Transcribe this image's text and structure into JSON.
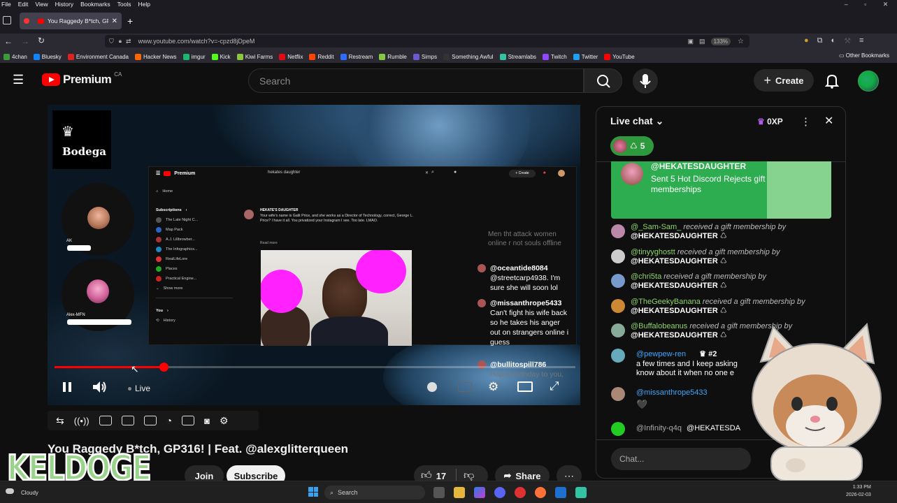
{
  "browser": {
    "menu": [
      "File",
      "Edit",
      "View",
      "History",
      "Bookmarks",
      "Tools",
      "Help"
    ],
    "tab_title": "You Raggedy B*tch, GP316! | Feat. @alexglitterqueen",
    "tab_title_display": "You Raggedy B*tch, GP316",
    "url": "www.youtube.com/watch?v=-cpzd8jDpeM",
    "zoom": "133%",
    "bookmarks": [
      {
        "label": "4chan",
        "color": "#3b9b3b"
      },
      {
        "label": "Bluesky",
        "color": "#1185fe"
      },
      {
        "label": "Environment Canada",
        "color": "#d22"
      },
      {
        "label": "Hacker News",
        "color": "#ff6600"
      },
      {
        "label": "imgur",
        "color": "#1bb76e"
      },
      {
        "label": "Kick",
        "color": "#53fc18"
      },
      {
        "label": "Kiwi Farms",
        "color": "#8cc63f"
      },
      {
        "label": "Netflix",
        "color": "#e50914"
      },
      {
        "label": "Reddit",
        "color": "#ff4500"
      },
      {
        "label": "Restream",
        "color": "#2f6bff"
      },
      {
        "label": "Rumble",
        "color": "#85c742"
      },
      {
        "label": "Simps",
        "color": "#6a5acd"
      },
      {
        "label": "Something Awful",
        "color": "#333"
      },
      {
        "label": "Streamlabs",
        "color": "#31c3a2"
      },
      {
        "label": "Twitch",
        "color": "#9146ff"
      },
      {
        "label": "Twitter",
        "color": "#1da1f2"
      },
      {
        "label": "YouTube",
        "color": "#ff0000"
      }
    ],
    "other_bookmarks": "Other Bookmarks"
  },
  "youtube": {
    "logo": "Premium",
    "region": "CA",
    "search_placeholder": "Search",
    "create_label": "Create",
    "video_title": "You Raggedy B*tch, GP316! | Feat. @alexglitterqueen",
    "join_label": "Join",
    "subscribe_label": "Subscribe",
    "like_count": "17",
    "share_label": "Share",
    "player": {
      "live_label": "Live",
      "progress": 0.21,
      "bodega_label": "Bodega",
      "participant_1": "AK",
      "participant_2": "Alex-MFN",
      "inner": {
        "logo": "Premium",
        "search_text": "hekates daughter",
        "create": "Create",
        "home": "Home",
        "subscriptions": "Subscriptions",
        "subs": [
          {
            "label": "The Late Night C...",
            "color": "#555"
          },
          {
            "label": "Map Pack",
            "color": "#2a66c9"
          },
          {
            "label": "A.J. Lillbrowber...",
            "color": "#a33"
          },
          {
            "label": "The Infographics...",
            "color": "#1e88c4"
          },
          {
            "label": "RealLifeLore",
            "color": "#d33"
          },
          {
            "label": "Places",
            "color": "#2a2"
          },
          {
            "label": "Practical Engine...",
            "color": "#c22"
          }
        ],
        "show_more": "Show more",
        "you": "You",
        "history": "History",
        "comment_author": "HEKATE'S DAUGHTER",
        "comment_text": "Your wife's name is Galit Price, and she works as a Director of Technology, correct, George L. Price? I have it all. You privatized your Instagram I see. Too late. LMAO.",
        "read_more": "Read more",
        "chat_faded": "Men tht attack women online r not souls offline",
        "chat": [
          {
            "user": "@oceantide8084",
            "text": "@streetcarp4938. I'm sure she will soon lol"
          },
          {
            "user": "@missanthrope5433",
            "text": "Can't fight his wife back so he takes his anger out on strangers online i guess"
          },
          {
            "user": "@bullitospill786",
            "text": "Happy birthday to you, girl"
          }
        ]
      }
    },
    "chat": {
      "title": "Live chat",
      "xp": "0XP",
      "members_count": "5",
      "gift_user": "@HEKATESDAUGHTER",
      "gift_text": "Sent 5 Hot Discord Rejects gift memberships",
      "messages": [
        {
          "user": "@_Sam-Sam_",
          "text": "received a gift membership by",
          "by": "@HEKATESDAUGHTER",
          "color": "#b8a"
        },
        {
          "user": "@tinyyghostt",
          "text": "received a gift membership by",
          "by": "@HEKATESDAUGHTER",
          "color": "#ccc"
        },
        {
          "user": "@chri5ta",
          "text": "received a gift membership by",
          "by": "@HEKATESDAUGHTER",
          "color": "#79c"
        },
        {
          "user": "@TheGeekyBanana",
          "text": "received a gift membership by",
          "by": "@HEKATESDAUGHTER",
          "color": "#c83"
        },
        {
          "user": "@Buffalobeanus",
          "text": "received a gift membership by",
          "by": "@HEKATESDAUGHTER",
          "color": "#8a9"
        }
      ],
      "pewpew_user": "@pewpew-ren",
      "pewpew_badge": "#2",
      "pewpew_text": "a few times and I keep asking know about it when no one e",
      "missanthrope_user": "@missanthrope5433",
      "missanthrope_text": "🖤",
      "infinity_user": "@Infinity-q4q",
      "infinity_text": "@HEKATESDA",
      "input_placeholder": "Chat..."
    },
    "overlay_text": "KELDOGE"
  },
  "taskbar": {
    "weather": "Cloudy",
    "search": "Search",
    "time": "1:33 PM",
    "date": "2026-02-03"
  }
}
